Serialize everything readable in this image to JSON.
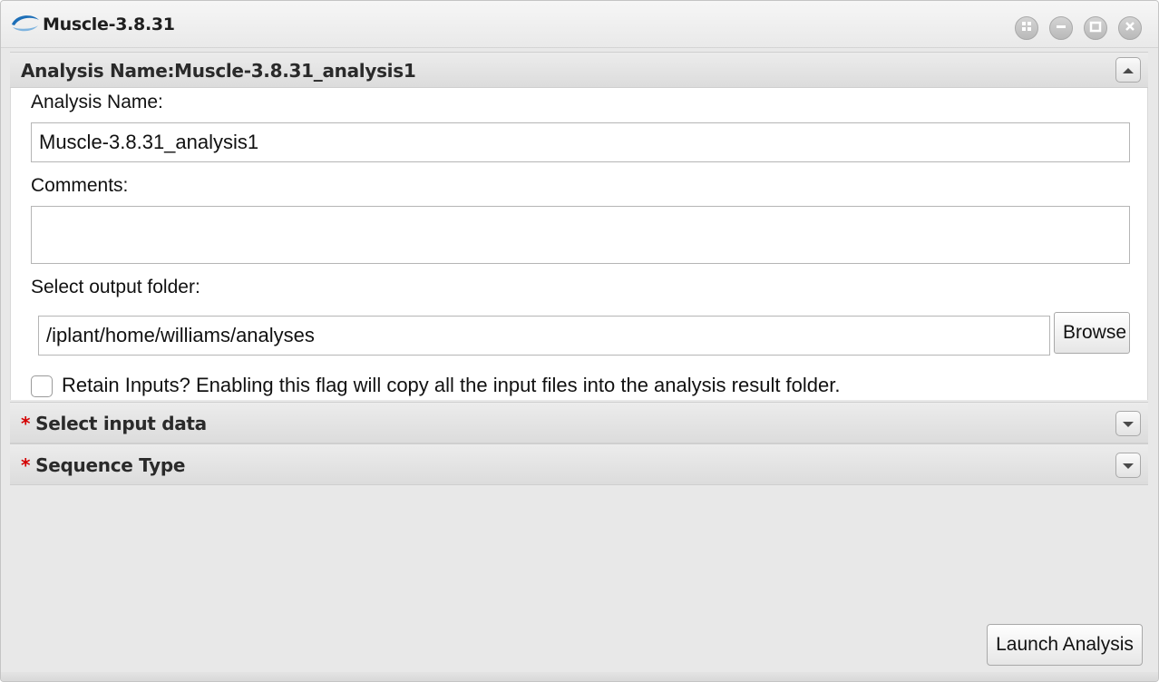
{
  "window": {
    "title": "Muscle-3.8.31",
    "logo_icon": "de-swoosh-logo-icon",
    "controls": [
      "grid-icon",
      "minimize-icon",
      "maximize-icon",
      "close-icon"
    ]
  },
  "colors": {
    "required_star": "#d40000",
    "panel_header": "#e2e2e2",
    "window_background": "#e8e8e8"
  },
  "panels": {
    "analysis": {
      "header": "Analysis Name:Muscle-3.8.31_analysis1",
      "expanded": true,
      "fields": {
        "analysis_name_label": "Analysis Name:",
        "analysis_name_value": "Muscle-3.8.31_analysis1",
        "comments_label": "Comments:",
        "comments_value": "",
        "output_folder_label": "Select output folder:",
        "output_folder_value": "/iplant/home/williams/analyses",
        "browse_label": "Browse",
        "retain_inputs_label": "Retain Inputs? Enabling this flag will copy all the input files into the analysis result folder.",
        "retain_inputs_checked": false
      }
    },
    "input_data": {
      "required_marker": "*",
      "header": "Select input data",
      "expanded": false
    },
    "sequence_type": {
      "required_marker": "*",
      "header": "Sequence Type",
      "expanded": false
    }
  },
  "footer": {
    "launch_label": "Launch Analysis"
  }
}
